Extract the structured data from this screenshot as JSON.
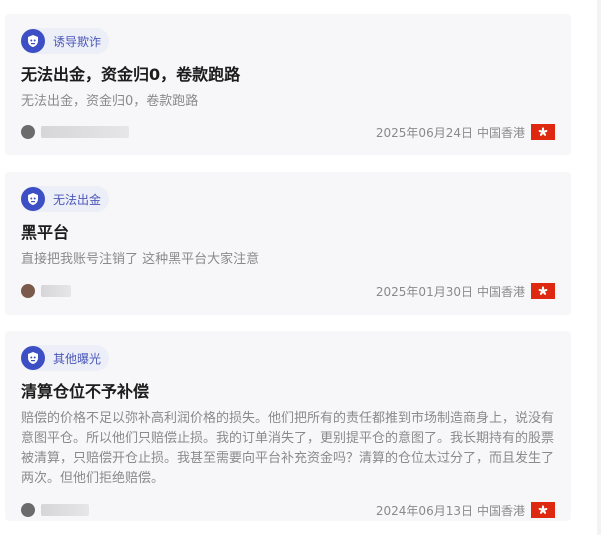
{
  "icons": {
    "tag": "bug-shield-icon",
    "flag": "hong-kong-flag-icon"
  },
  "colors": {
    "accent": "#3d4fc4",
    "flag_red": "#de2910"
  },
  "cards": [
    {
      "tag": "诱导欺诈",
      "title": "无法出金，资金归0，卷款跑路",
      "description": "无法出金，资金归0，卷款跑路",
      "date": "2025年06月24日",
      "region": "中国香港"
    },
    {
      "tag": "无法出金",
      "title": "黑平台",
      "description": "直接把我账号注销了 这种黑平台大家注意",
      "date": "2025年01月30日",
      "region": "中国香港"
    },
    {
      "tag": "其他曝光",
      "title": "清算仓位不予补偿",
      "description": "赔偿的价格不足以弥补高利润价格的损失。他们把所有的责任都推到市场制造商身上，说没有意图平仓。所以他们只赔偿止损。我的订单消失了，更别提平仓的意图了。我长期持有的股票被清算，只赔偿开仓止损。我甚至需要向平台补充资金吗？清算的仓位太过分了，而且发生了两次。但他们拒绝赔偿。",
      "date": "2024年06月13日",
      "region": "中国香港"
    }
  ]
}
